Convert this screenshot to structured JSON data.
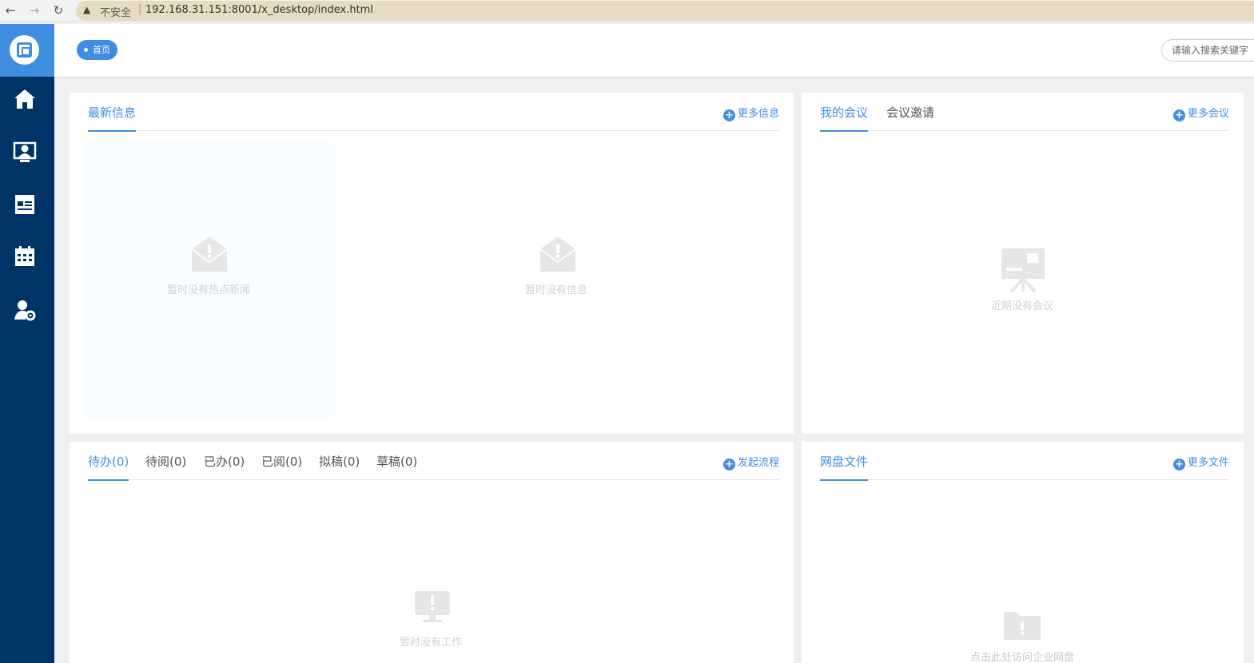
{
  "browser": {
    "insecure_label": "不安全",
    "separator": "|",
    "url": "192.168.31.151:8001/x_desktop/index.html"
  },
  "sidebar": {
    "items": [
      {
        "icon": "home-icon"
      },
      {
        "icon": "person-screen-icon"
      },
      {
        "icon": "document-list-icon"
      },
      {
        "icon": "calendar-icon"
      },
      {
        "icon": "user-settings-icon"
      }
    ]
  },
  "header": {
    "home_tab": "首页",
    "search_placeholder": "请输入搜索关键字"
  },
  "news_panel": {
    "tab": "最新信息",
    "more": "更多信息",
    "hot_empty": "暂时没有热点新闻",
    "info_empty": "暂时没有信息"
  },
  "meeting_panel": {
    "tabs": [
      "我的会议",
      "会议邀请"
    ],
    "more": "更多会议",
    "empty": "近期没有会议"
  },
  "task_panel": {
    "tabs": [
      "待办(0)",
      "待阅(0)",
      "已办(0)",
      "已阅(0)",
      "拟稿(0)",
      "草稿(0)"
    ],
    "more": "发起流程",
    "empty": "暂时没有工作"
  },
  "disk_panel": {
    "tab": "网盘文件",
    "more": "更多文件",
    "empty": "点击此处访问企业网盘"
  },
  "colors": {
    "sidebar": "#003366",
    "accent": "#3f8ee0",
    "address_bar": "#e6dcc0"
  }
}
